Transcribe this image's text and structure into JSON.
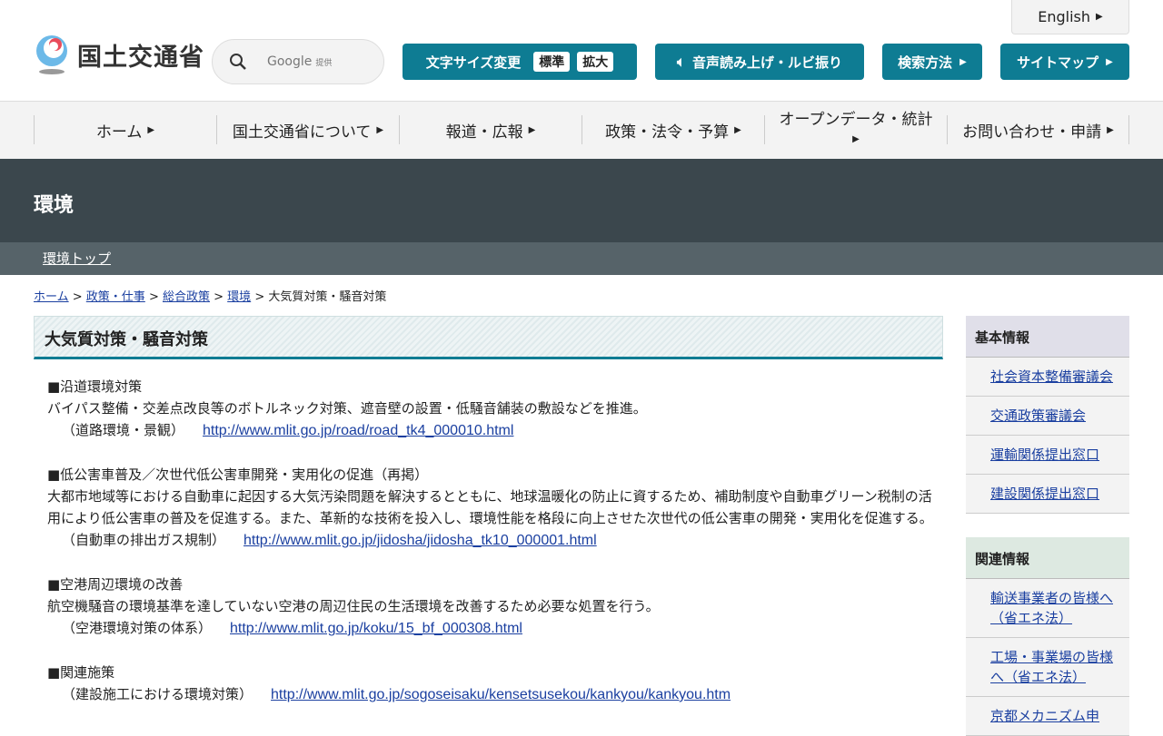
{
  "header": {
    "english": "English",
    "logo_text": "国土交通省",
    "search_provider": "Google",
    "search_provided": "提供",
    "font_size_label": "文字サイズ変更",
    "font_standard": "標準",
    "font_large": "拡大",
    "voice": "音声読み上げ・ルビ振り",
    "search_method": "検索方法",
    "sitemap": "サイトマップ"
  },
  "nav": [
    "ホーム",
    "国土交通省について",
    "報道・広報",
    "政策・法令・予算",
    "オープンデータ・統計",
    "お問い合わせ・申請"
  ],
  "section": {
    "title": "環境",
    "sub_link": "環境トップ"
  },
  "breadcrumb": {
    "items": [
      "ホーム",
      "政策・仕事",
      "総合政策",
      "環境"
    ],
    "current": "大気質対策・騒音対策"
  },
  "page_title": "大気質対策・騒音対策",
  "content": [
    {
      "heading": "■沿道環境対策",
      "text": "バイパス整備・交差点改良等のボトルネック対策、遮音壁の設置・低騒音舗装の敷設などを推進。",
      "ref": "（道路環境・景観）",
      "url": "http://www.mlit.go.jp/road/road_tk4_000010.html"
    },
    {
      "heading": "■低公害車普及／次世代低公害車開発・実用化の促進（再掲）",
      "text": "大都市地域等における自動車に起因する大気汚染問題を解決するとともに、地球温暖化の防止に資するため、補助制度や自動車グリーン税制の活用により低公害車の普及を促進する。また、革新的な技術を投入し、環境性能を格段に向上させた次世代の低公害車の開発・実用化を促進する。",
      "ref": "（自動車の排出ガス規制）",
      "url": "http://www.mlit.go.jp/jidosha/jidosha_tk10_000001.html"
    },
    {
      "heading": "■空港周辺環境の改善",
      "text": "航空機騒音の環境基準を達していない空港の周辺住民の生活環境を改善するため必要な処置を行う。",
      "ref": "（空港環境対策の体系）",
      "url": "http://www.mlit.go.jp/koku/15_bf_000308.html"
    },
    {
      "heading": "■関連施策",
      "ref": "（建設施工における環境対策）",
      "url": "http://www.mlit.go.jp/sogoseisaku/kensetsusekou/kankyou/kankyou.htm"
    }
  ],
  "sidebar": {
    "basic": {
      "title": "基本情報",
      "items": [
        "社会資本整備審議会",
        "交通政策審議会",
        "運輸関係提出窓口",
        "建設関係提出窓口"
      ]
    },
    "related": {
      "title": "関連情報",
      "items": [
        "輸送事業者の皆様へ（省エネ法）",
        "工場・事業場の皆様へ（省エネ法）",
        "京都メカニズム申"
      ]
    }
  }
}
